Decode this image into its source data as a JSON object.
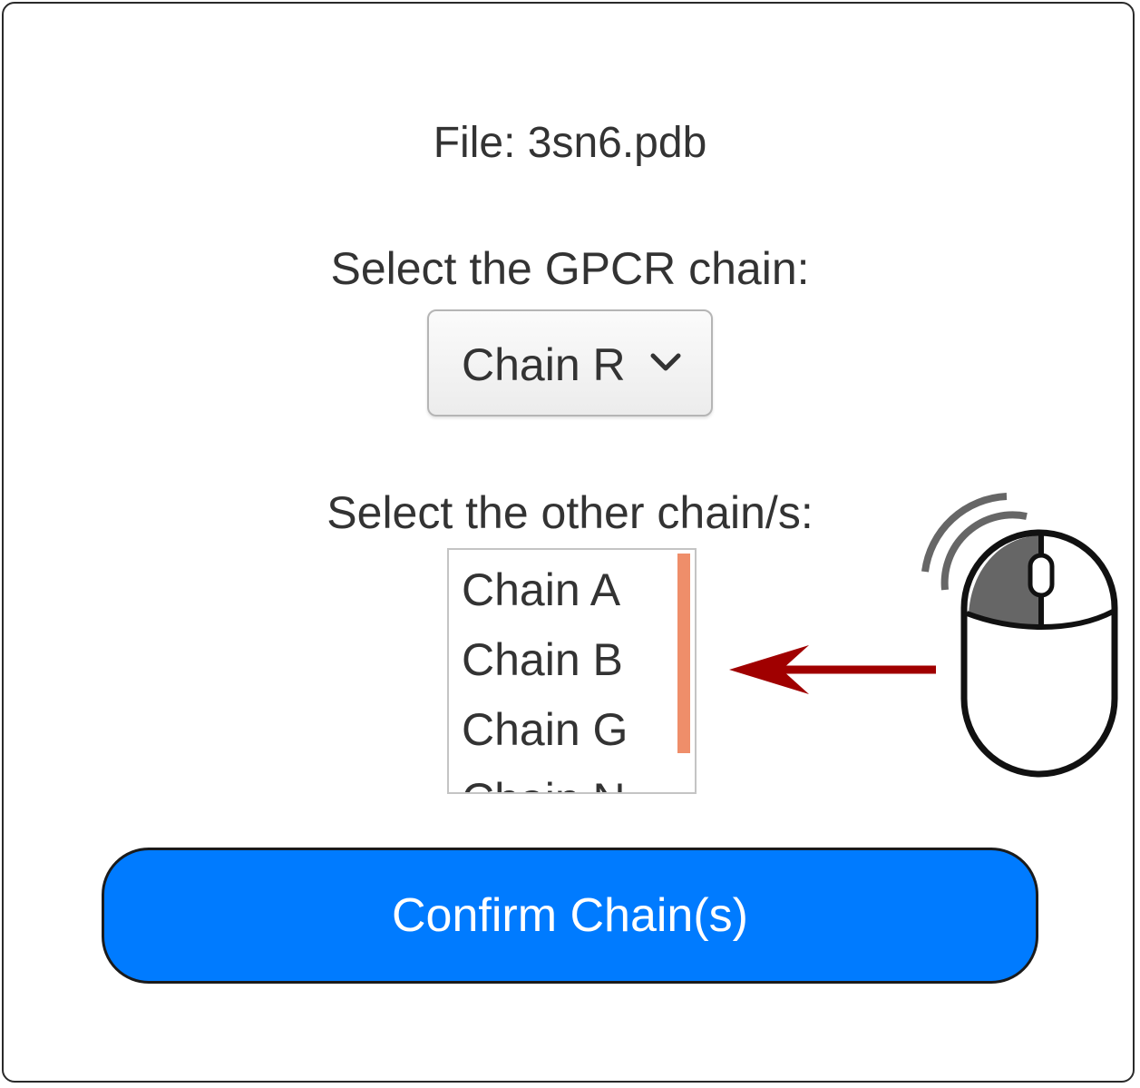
{
  "file": {
    "label": "File: 3sn6.pdb"
  },
  "gpcr": {
    "label": "Select the GPCR chain:",
    "selected": "Chain R"
  },
  "other_chains": {
    "label": "Select the other chain/s:",
    "options": [
      "Chain A",
      "Chain B",
      "Chain G",
      "Chain N"
    ]
  },
  "confirm": {
    "label": "Confirm Chain(s)"
  },
  "annotation": {
    "arrow_color": "#a00000",
    "scrollbar_color": "#ef8e6a",
    "button_color": "#007bff",
    "icon": "mouse-scroll-wheel-icon"
  }
}
